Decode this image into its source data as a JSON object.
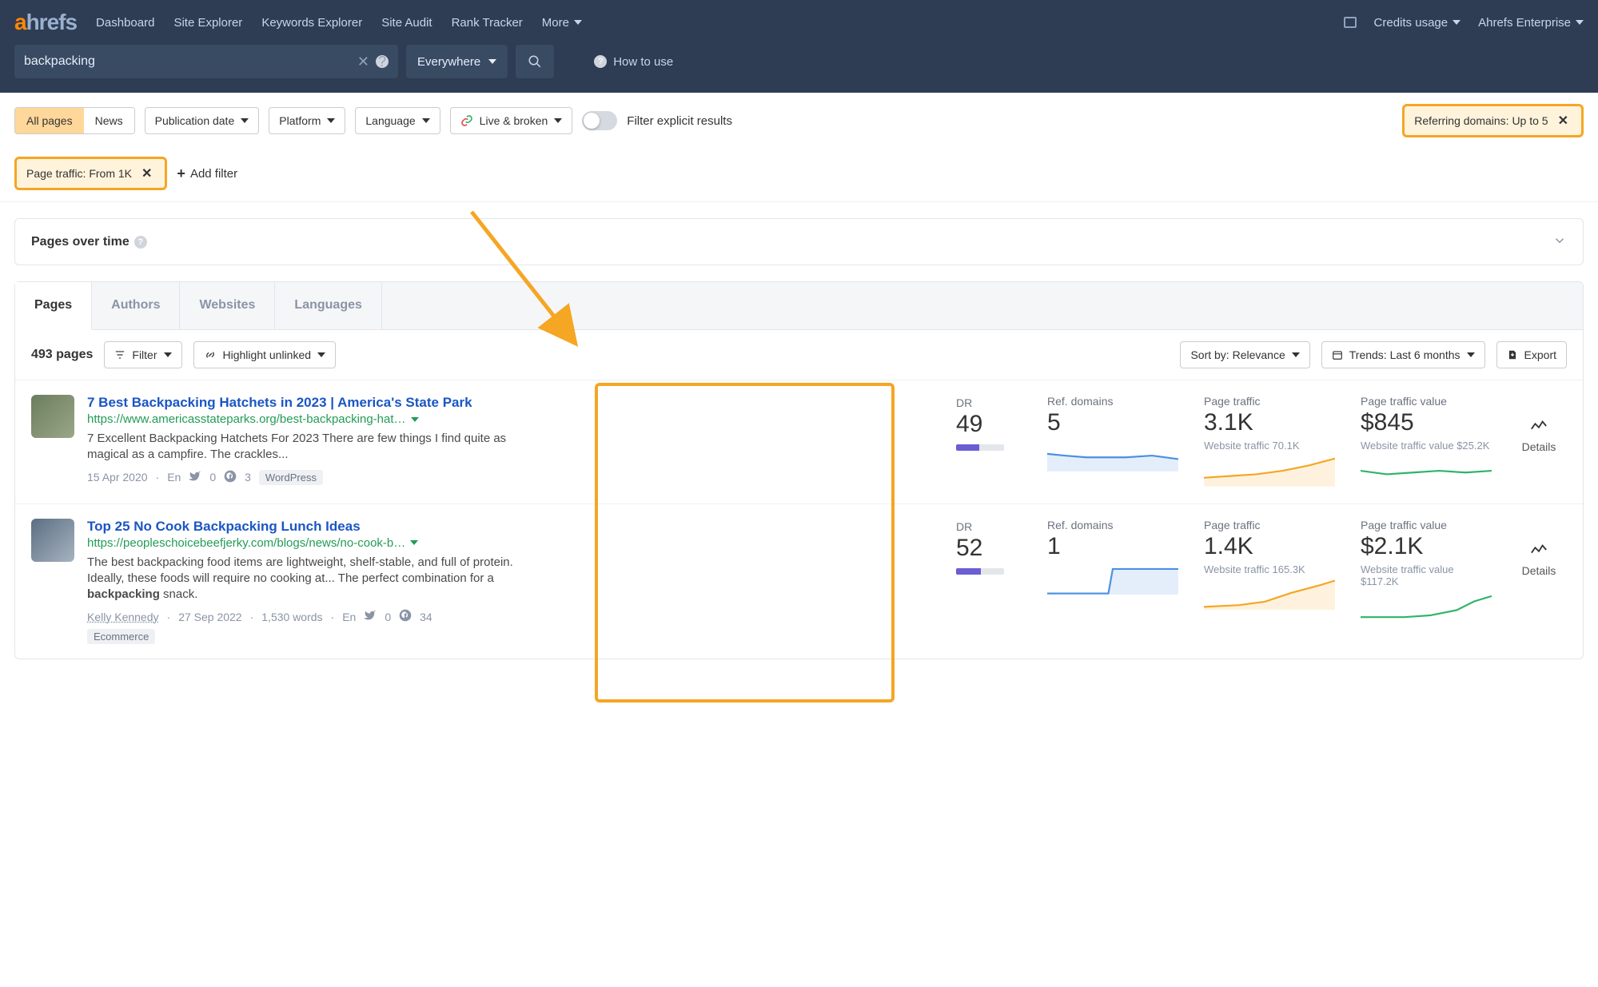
{
  "nav": {
    "logo_a": "a",
    "logo_rest": "hrefs",
    "items": [
      "Dashboard",
      "Site Explorer",
      "Keywords Explorer",
      "Site Audit",
      "Rank Tracker",
      "More"
    ],
    "right": {
      "credits": "Credits usage",
      "account": "Ahrefs Enterprise"
    }
  },
  "search": {
    "value": "backpacking",
    "scope": "Everywhere",
    "howto": "How to use"
  },
  "filters": {
    "tab_all": "All pages",
    "tab_news": "News",
    "pub_date": "Publication date",
    "platform": "Platform",
    "language": "Language",
    "live_broken": "Live & broken",
    "explicit": "Filter explicit results",
    "ref_domains": "Referring domains: Up to 5",
    "page_traffic": "Page traffic: From 1K",
    "add_filter": "Add filter"
  },
  "pages_over_time": "Pages over time",
  "result_tabs": [
    "Pages",
    "Authors",
    "Websites",
    "Languages"
  ],
  "toolbar": {
    "count": "493 pages",
    "filter": "Filter",
    "highlight": "Highlight unlinked",
    "sort": "Sort by: Relevance",
    "trends": "Trends: Last 6 months",
    "export": "Export"
  },
  "metric_labels": {
    "dr": "DR",
    "ref": "Ref. domains",
    "traffic": "Page traffic",
    "value": "Page traffic value",
    "website_traffic": "Website traffic",
    "website_value": "Website traffic value",
    "details": "Details"
  },
  "rows": [
    {
      "title": "7 Best Backpacking Hatchets in 2023 | America's State Park",
      "url": "https://www.americasstateparks.org/best-backpacking-hat…",
      "snippet": "7 Excellent Backpacking Hatchets For 2023 There are few things I find quite as magical as a campfire. The crackles...",
      "date": "15 Apr 2020",
      "lang": "En",
      "twitter": "0",
      "pinterest": "3",
      "platform_tag": "WordPress",
      "dr": "49",
      "dr_fill": 49,
      "ref_domains": "5",
      "page_traffic": "3.1K",
      "website_traffic": "70.1K",
      "traffic_value": "$845",
      "website_value": "$25.2K"
    },
    {
      "title": "Top 25 No Cook Backpacking Lunch Ideas",
      "url": "https://peopleschoicebeefjerky.com/blogs/news/no-cook-b…",
      "snippet_html": "The best backpacking food items are lightweight, shelf-stable, and full of protein. Ideally, these foods will require no cooking at... The perfect combination for a <b>backpacking</b> snack.",
      "author": "Kelly Kennedy",
      "date": "27 Sep 2022",
      "words": "1,530 words",
      "lang": "En",
      "twitter": "0",
      "pinterest": "34",
      "platform_tag": "Ecommerce",
      "dr": "52",
      "dr_fill": 52,
      "ref_domains": "1",
      "page_traffic": "1.4K",
      "website_traffic": "165.3K",
      "traffic_value": "$2.1K",
      "website_value": "$117.2K"
    }
  ]
}
